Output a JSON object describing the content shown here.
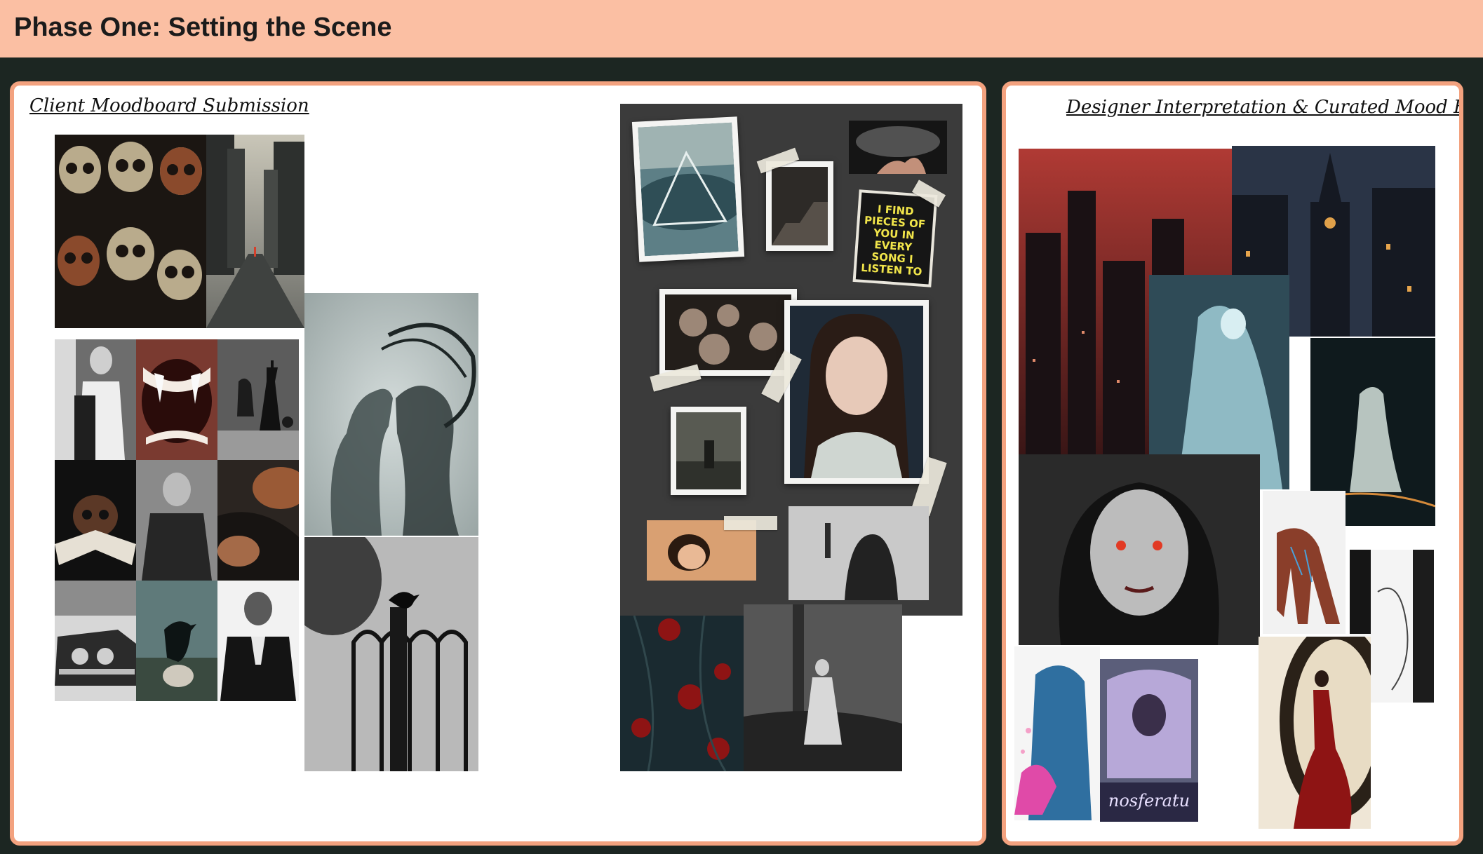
{
  "header": {
    "title": "Phase One: Setting the Scene"
  },
  "client_panel": {
    "title": "Client Moodboard Submission"
  },
  "designer_panel": {
    "title": "Designer Interpretation & Curated Mood Board"
  },
  "collage_note": {
    "text": "I FIND PIECES OF YOU IN EVERY SONG I LISTEN TO"
  },
  "poster": {
    "text": "nosferatu"
  },
  "colors": {
    "header_bg": "#fbbfa3",
    "page_bg": "#1c2622",
    "panel_border": "#f3a27f",
    "board_dark": "#3b3b3b"
  },
  "icons": [
    "skull-icon",
    "crow-icon",
    "chess-king-icon",
    "rose-icon",
    "ghost-icon"
  ]
}
